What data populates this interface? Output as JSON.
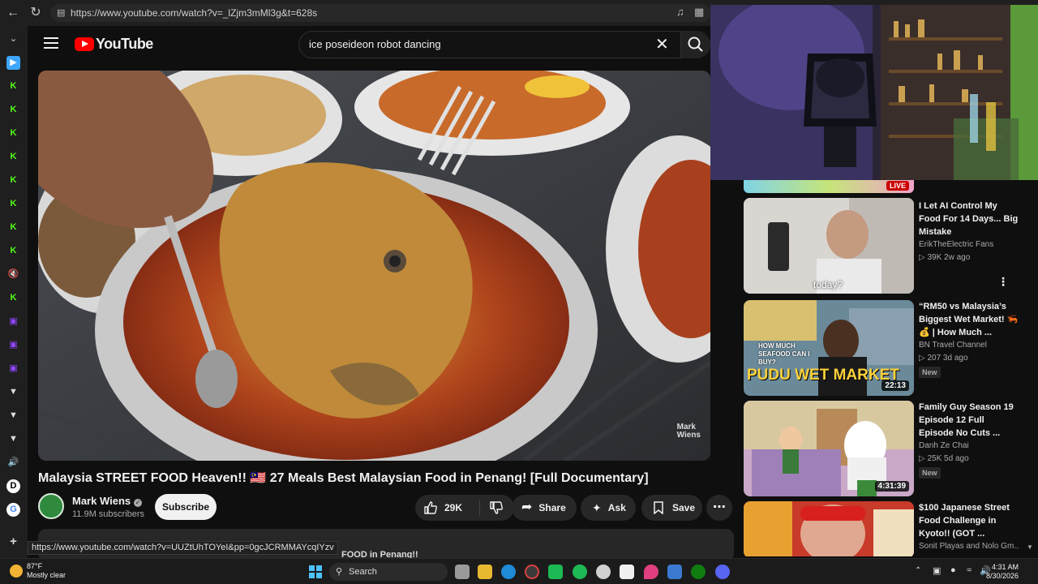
{
  "browser": {
    "url": "https://www.youtube.com/watch?v=_lZjm3mMl3g&t=628s",
    "status_url": "https://www.youtube.com/watch?v=UUZtUhTOYeI&pp=0gcJCRMMAYcqIYzv"
  },
  "header": {
    "logo_text": "YouTube",
    "search_value": "ice poseideon robot dancing"
  },
  "video": {
    "title": "Malaysia STREET FOOD Heaven!! 🇲🇾 27 Meals Best Malaysian Food in Penang! [Full Documentary]",
    "watermark_line1": "Mark",
    "watermark_line2": "Wiens",
    "channel_name": "Mark Wiens",
    "subscribers": "11.9M subscribers",
    "subscribe_label": "Subscribe",
    "like_count": "29K",
    "share_label": "Share",
    "ask_label": "Ask",
    "save_label": "Save",
    "description_snippet": "FOOD in Penang!!"
  },
  "live_strip": {
    "badge": "LIVE"
  },
  "recommendations": [
    {
      "title": "I Let AI Control My Food For 14 Days... Big Mistake",
      "channel": "ErikTheElectric Fans",
      "stats": "▷ 39K  2w ago",
      "caption": "today?",
      "duration": "",
      "new": ""
    },
    {
      "title": "“RM50 vs Malaysia’s Biggest Wet Market! 🦐💰 | How Much ...",
      "channel": "BN Travel Channel",
      "stats": "▷ 207  3d ago",
      "caption": "PUDU WET MARKET",
      "caption2": "HOW MUCH SEAFOOD CAN I BUY?",
      "duration": "22:13",
      "new": "New"
    },
    {
      "title": "Family Guy Season 19 Episode 12 Full Episode No Cuts ...",
      "channel": "Danh Ze Chai",
      "stats": "▷ 25K  5d ago",
      "caption": "",
      "duration": "4:31:39",
      "new": "New"
    },
    {
      "title": "$100 Japanese Street Food Challenge in Kyoto!! (GOT ...",
      "channel": "Sonit Playas and Nolo Gm...",
      "stats": "",
      "caption": "",
      "duration": "",
      "new": ""
    }
  ],
  "taskbar": {
    "temperature": "87°F",
    "weather": "Mostly clear",
    "search_label": "Search",
    "time": "4:31 AM",
    "date": "8/30/2026"
  },
  "colors": {
    "youtube_red": "#ff0000",
    "background": "#0f0f0f",
    "pill": "#272727",
    "kick_green": "#53fc18",
    "twitch_purple": "#9146ff"
  }
}
